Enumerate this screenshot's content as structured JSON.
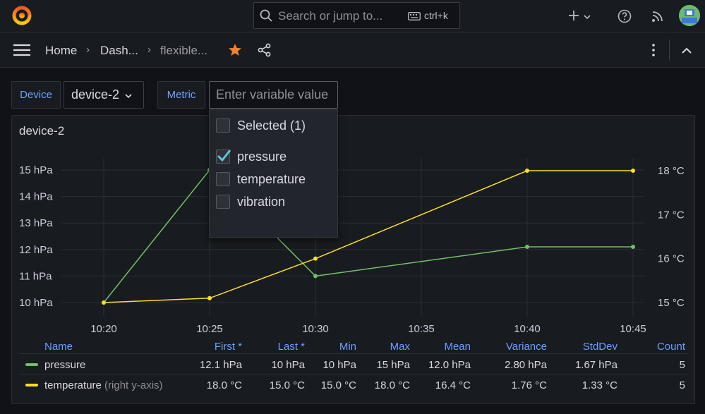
{
  "topbar": {
    "search_placeholder": "Search or jump to...",
    "shortcut": "ctrl+k",
    "icons": [
      "grafana-logo-icon",
      "search-icon",
      "keyboard-icon",
      "plus-icon",
      "chevron-down-icon",
      "help-icon",
      "rss-icon",
      "avatar"
    ]
  },
  "navbar": {
    "breadcrumbs": [
      "Home",
      "Dash...",
      "flexible..."
    ],
    "starred": true
  },
  "variables": {
    "device_label": "Device",
    "device_value": "device-2",
    "metric_label": "Metric",
    "metric_placeholder": "Enter variable value"
  },
  "metric_dropdown": {
    "selected_header": "Selected (1)",
    "options": [
      {
        "label": "pressure",
        "checked": true
      },
      {
        "label": "temperature",
        "checked": false
      },
      {
        "label": "vibration",
        "checked": false
      }
    ]
  },
  "panel": {
    "title": "device-2"
  },
  "chart_data": {
    "type": "line",
    "x": [
      "10:20",
      "10:25",
      "10:30",
      "10:40",
      "10:45"
    ],
    "x_ticks": [
      "10:20",
      "10:25",
      "10:30",
      "10:35",
      "10:40",
      "10:45"
    ],
    "left_ticks": [
      "15 hPa",
      "14 hPa",
      "13 hPa",
      "12 hPa",
      "11 hPa",
      "10 hPa"
    ],
    "right_ticks": [
      "18 °C",
      "17 °C",
      "16 °C",
      "15 °C"
    ],
    "left_ylim": [
      10,
      15
    ],
    "right_ylim": [
      15,
      18
    ],
    "grid": true,
    "series": [
      {
        "name": "pressure",
        "axis": "left",
        "color": "#73bf69",
        "values": [
          10,
          15,
          11,
          12.1,
          12.1
        ]
      },
      {
        "name": "temperature",
        "axis": "right",
        "color": "#fade2a",
        "values": [
          15.0,
          15.1,
          16.0,
          18.0,
          18.0
        ]
      }
    ]
  },
  "legend": {
    "headers": [
      "Name",
      "First *",
      "Last *",
      "Min",
      "Max",
      "Mean",
      "Variance",
      "StdDev",
      "Count"
    ],
    "rows": [
      {
        "name": "pressure",
        "suffix": "",
        "color": "#73bf69",
        "values": [
          "12.1 hPa",
          "10 hPa",
          "10 hPa",
          "15 hPa",
          "12.0 hPa",
          "2.80 hPa",
          "1.67 hPa",
          "5"
        ]
      },
      {
        "name": "temperature",
        "suffix": " (right y-axis)",
        "color": "#fade2a",
        "values": [
          "18.0 °C",
          "15.0 °C",
          "15.0 °C",
          "18.0 °C",
          "16.4 °C",
          "1.76 °C",
          "1.33 °C",
          "5"
        ]
      }
    ]
  }
}
